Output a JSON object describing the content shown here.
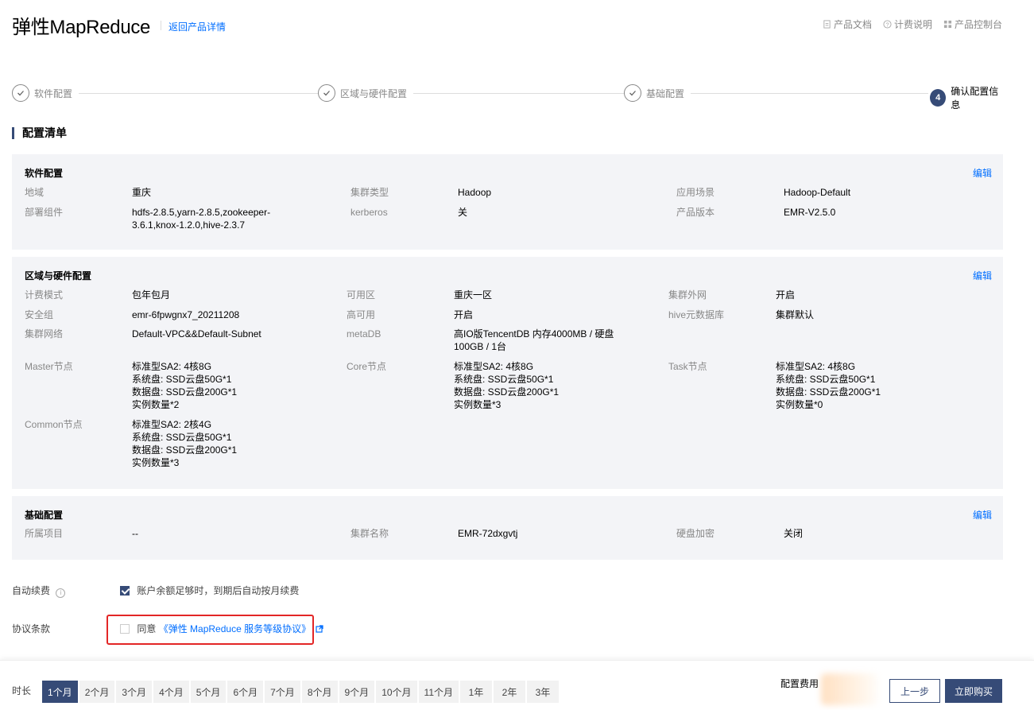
{
  "header": {
    "title": "弹性MapReduce",
    "back_link": "返回产品详情",
    "links": [
      {
        "icon": "document-icon",
        "label": "产品文档"
      },
      {
        "icon": "help-circle-icon",
        "label": "计费说明"
      },
      {
        "icon": "grid-icon",
        "label": "产品控制台"
      }
    ]
  },
  "steps": [
    {
      "label": "软件配置",
      "status": "done"
    },
    {
      "label": "区域与硬件配置",
      "status": "done"
    },
    {
      "label": "基础配置",
      "status": "done"
    },
    {
      "label": "确认配置信息",
      "status": "active",
      "number": "4"
    }
  ],
  "section_title": "配置清单",
  "software": {
    "title": "软件配置",
    "edit": "编辑",
    "items": [
      {
        "k": "地域",
        "v": "重庆"
      },
      {
        "k": "集群类型",
        "v": "Hadoop"
      },
      {
        "k": "应用场景",
        "v": "Hadoop-Default"
      },
      {
        "k": "部署组件",
        "v": "hdfs-2.8.5,yarn-2.8.5,zookeeper-3.6.1,knox-1.2.0,hive-2.3.7"
      },
      {
        "k": "kerberos",
        "v": "关"
      },
      {
        "k": "产品版本",
        "v": "EMR-V2.5.0"
      }
    ]
  },
  "hardware": {
    "title": "区域与硬件配置",
    "edit": "编辑",
    "items": [
      {
        "k": "计费模式",
        "v": "包年包月"
      },
      {
        "k": "可用区",
        "v": "重庆一区"
      },
      {
        "k": "集群外网",
        "v": "开启"
      },
      {
        "k": "安全组",
        "v": "emr-6fpwgnx7_20211208"
      },
      {
        "k": "高可用",
        "v": "开启"
      },
      {
        "k": "hive元数据库",
        "v": "集群默认"
      },
      {
        "k": "集群网络",
        "v": "Default-VPC&&Default-Subnet"
      },
      {
        "k": "metaDB",
        "v": "高IO版TencentDB 内存4000MB / 硬盘100GB / 1台"
      },
      {
        "k": "Master节点",
        "v": "标准型SA2: 4核8G\n系统盘: SSD云盘50G*1\n数据盘: SSD云盘200G*1\n实例数量*2"
      },
      {
        "k": "Core节点",
        "v": "标准型SA2: 4核8G\n系统盘: SSD云盘50G*1\n数据盘: SSD云盘200G*1\n实例数量*3"
      },
      {
        "k": "Task节点",
        "v": "标准型SA2: 4核8G\n系统盘: SSD云盘50G*1\n数据盘: SSD云盘200G*1\n实例数量*0"
      },
      {
        "k": "Common节点",
        "v": "标准型SA2: 2核4G\n系统盘: SSD云盘50G*1\n数据盘: SSD云盘200G*1\n实例数量*3"
      }
    ]
  },
  "basic": {
    "title": "基础配置",
    "edit": "编辑",
    "items": [
      {
        "k": "所属项目",
        "v": "--"
      },
      {
        "k": "集群名称",
        "v": "EMR-72dxgvtj"
      },
      {
        "k": "硬盘加密",
        "v": "关闭"
      }
    ]
  },
  "auto_renew": {
    "label": "自动续费",
    "text": "账户余额足够时，到期后自动按月续费",
    "checked": true
  },
  "agreement": {
    "label": "协议条款",
    "prefix": "同意",
    "link": "《弹性 MapReduce 服务等级协议》",
    "checked": false
  },
  "footer": {
    "duration_label": "时长",
    "durations": [
      "1个月",
      "2个月",
      "3个月",
      "4个月",
      "5个月",
      "6个月",
      "7个月",
      "8个月",
      "9个月",
      "10个月",
      "11个月",
      "1年",
      "2年",
      "3年"
    ],
    "selected": "1个月",
    "fee_label": "配置费用",
    "prev": "上一步",
    "buy": "立即购买"
  },
  "colors": {
    "primary": "#364b77",
    "link": "#006eff",
    "panel_bg": "#f3f4f7",
    "highlight_border": "#e32626"
  }
}
